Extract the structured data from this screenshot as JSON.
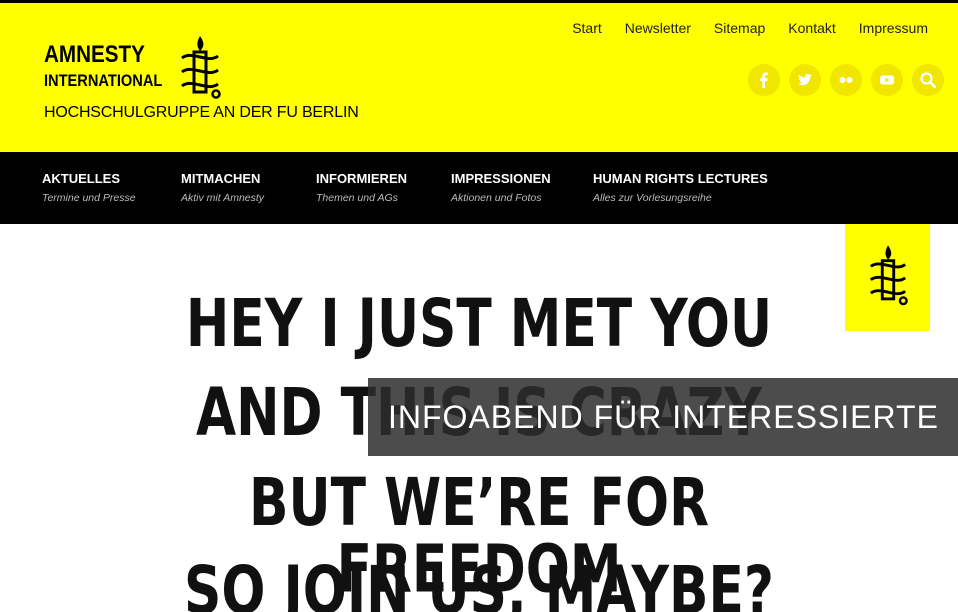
{
  "brand": {
    "name_line1": "AMNESTY",
    "name_line2": "INTERNATIONAL",
    "subtitle": "HOCHSCHULGRUPPE AN DER FU BERLIN"
  },
  "colors": {
    "brand_yellow": "#ffff00",
    "nav_black": "#000000",
    "overlay": "#2d2d2d"
  },
  "top_nav": [
    {
      "label": "Start"
    },
    {
      "label": "Newsletter"
    },
    {
      "label": "Sitemap"
    },
    {
      "label": "Kontakt"
    },
    {
      "label": "Impressum"
    }
  ],
  "social": [
    "facebook-icon",
    "twitter-icon",
    "flickr-icon",
    "youtube-icon",
    "search-icon"
  ],
  "main_nav": [
    {
      "label": "AKTUELLES",
      "sub": "Termine und Presse"
    },
    {
      "label": "MITMACHEN",
      "sub": "Aktiv mit Amnesty"
    },
    {
      "label": "INFORMIEREN",
      "sub": "Themen und AGs"
    },
    {
      "label": "IMPRESSIONEN",
      "sub": "Aktionen und Fotos"
    },
    {
      "label": "HUMAN RIGHTS LECTURES",
      "sub": "Alles zur Vorlesungsreihe"
    }
  ],
  "hero": {
    "lines": [
      "HEY I JUST MET YOU",
      "AND THIS IS CRAZY",
      "BUT WE’RE FOR FREEDOM",
      "SO JOIN US, MAYBE?"
    ],
    "caption": "INFOABEND FÜR INTERESSIERTE"
  }
}
